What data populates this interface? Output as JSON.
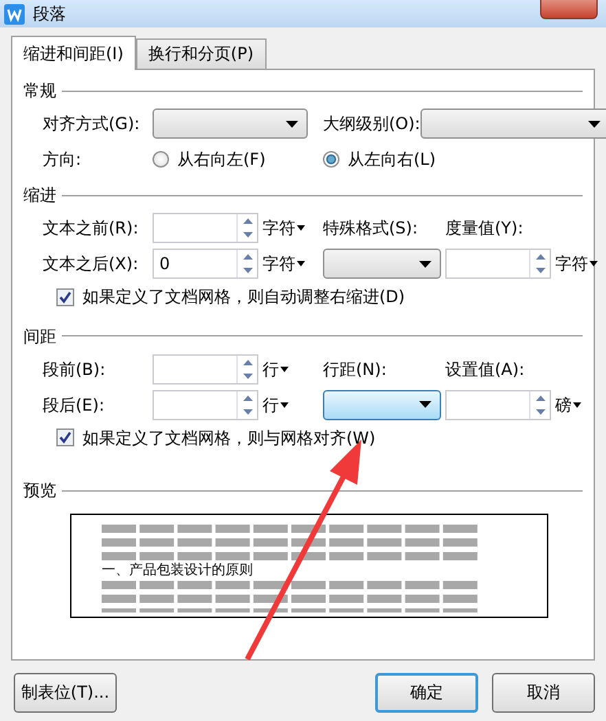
{
  "window": {
    "title": "段落"
  },
  "tabs": [
    {
      "label": "缩进和间距(I)",
      "selected": true
    },
    {
      "label": "换行和分页(P)",
      "selected": false
    }
  ],
  "general": {
    "title": "常规",
    "alignment": {
      "label": "对齐方式(G):"
    },
    "outline": {
      "label": "大纲级别(O):"
    },
    "direction": {
      "label": "方向:",
      "options": [
        {
          "label": "从右向左(F)",
          "selected": false
        },
        {
          "label": "从左向右(L)",
          "selected": true
        }
      ]
    }
  },
  "indent": {
    "title": "缩进",
    "before": {
      "label": "文本之前(R):",
      "unit": "字符"
    },
    "after": {
      "label": "文本之后(X):",
      "value": "0",
      "unit": "字符"
    },
    "special": {
      "label": "特殊格式(S):"
    },
    "measure": {
      "label": "度量值(Y):",
      "unit": "字符"
    },
    "grid_option": {
      "label": "如果定义了文档网格，则自动调整右缩进(D)",
      "checked": true
    }
  },
  "spacing": {
    "title": "间距",
    "before": {
      "label": "段前(B):",
      "unit": "行"
    },
    "after": {
      "label": "段后(E):",
      "unit": "行"
    },
    "line": {
      "label": "行距(N):",
      "hovered": true
    },
    "setting": {
      "label": "设置值(A):",
      "unit": "磅"
    },
    "grid_option": {
      "label": "如果定义了文档网格，则与网格对齐(W)",
      "checked": true
    }
  },
  "preview": {
    "title": "预览",
    "heading": "一、产品包装设计的原则"
  },
  "buttons": [
    {
      "label": "制表位(T)...",
      "default": false
    },
    {
      "label": "确定",
      "default": true
    },
    {
      "label": "取消",
      "default": false
    }
  ]
}
